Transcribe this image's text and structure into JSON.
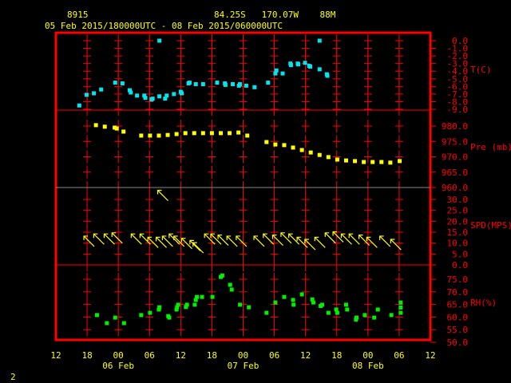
{
  "header": {
    "station": "8915",
    "location": "84.25S   170.07W    88M",
    "period": "05 Feb 2015/180000UTC - 08 Feb 2015/060000UTC"
  },
  "footer": {
    "page_number": "2"
  },
  "colors": {
    "frame": "#ff0000",
    "text": "#ffff00",
    "temperature": "#00e5ee",
    "pressure": "#ffff00",
    "wind": "#ffff00",
    "rh": "#00ee00"
  },
  "chart_data": {
    "type": "scatter",
    "title": "8915  84.25S 170.07W 88M",
    "subtitle": "05 Feb 2015/180000UTC - 08 Feb 2015/060000UTC",
    "x_unit": "hours since 05 Feb 12Z",
    "xlim": [
      0,
      72
    ],
    "x_ticks": [
      "12",
      "18",
      "00",
      "06",
      "12",
      "18",
      "00",
      "06",
      "12",
      "18",
      "00",
      "06",
      "12"
    ],
    "x_day_labels": [
      {
        "label": "06 Feb",
        "hour": 12
      },
      {
        "label": "07 Feb",
        "hour": 36
      },
      {
        "label": "08 Feb",
        "hour": 60
      }
    ],
    "panels": [
      {
        "name": "temperature",
        "label": "T(C)",
        "ylim": [
          -9,
          0
        ],
        "ticks": [
          "0.0",
          "-1.0",
          "-2.0",
          "-3.0",
          "-4.0",
          "-5.0",
          "-6.0",
          "-7.0",
          "-8.0",
          "-9.0"
        ],
        "tick_values": [
          0,
          -1,
          -2,
          -3,
          -4,
          -5,
          -6,
          -7,
          -8,
          -9
        ],
        "points": [
          [
            4.5,
            -8.5
          ],
          [
            5.9,
            -7.1
          ],
          [
            7.3,
            -6.9
          ],
          [
            8.7,
            -6.4
          ],
          [
            11.4,
            -5.5
          ],
          [
            12.8,
            -5.6
          ],
          [
            14.2,
            -6.5
          ],
          [
            14.4,
            -6.8
          ],
          [
            15.6,
            -7.2
          ],
          [
            17.0,
            -7.2
          ],
          [
            17.2,
            -7.5
          ],
          [
            18.4,
            -7.7
          ],
          [
            18.6,
            -7.6
          ],
          [
            19.9,
            -7.3
          ],
          [
            21.0,
            -7.6
          ],
          [
            21.3,
            -7.2
          ],
          [
            22.7,
            -7.0
          ],
          [
            24.0,
            -6.7
          ],
          [
            24.2,
            -6.9
          ],
          [
            25.5,
            -5.6
          ],
          [
            25.7,
            -5.5
          ],
          [
            26.9,
            -5.7
          ],
          [
            28.3,
            -5.7
          ],
          [
            31.0,
            -5.5
          ],
          [
            32.5,
            -5.6
          ],
          [
            32.6,
            -5.8
          ],
          [
            34.0,
            -5.7
          ],
          [
            35.2,
            -5.9
          ],
          [
            35.4,
            -5.7
          ],
          [
            36.6,
            -5.9
          ],
          [
            38.2,
            -6.1
          ],
          [
            40.8,
            -5.5
          ],
          [
            42.2,
            -4.3
          ],
          [
            42.4,
            -3.9
          ],
          [
            43.6,
            -4.3
          ],
          [
            45.1,
            -3.0
          ],
          [
            45.2,
            -3.2
          ],
          [
            46.5,
            -3.0
          ],
          [
            46.6,
            -3.1
          ],
          [
            47.9,
            -2.9
          ],
          [
            48.7,
            -3.3
          ],
          [
            48.9,
            -3.4
          ],
          [
            50.7,
            -3.75
          ],
          [
            52.1,
            -4.4
          ],
          [
            52.2,
            -4.6
          ],
          [
            19.9,
            0.0
          ],
          [
            50.7,
            0.0
          ]
        ]
      },
      {
        "name": "pressure",
        "label": "Pre (mb)",
        "ylim": [
          957.5,
          985
        ],
        "ticks": [
          "980.0",
          "975.0",
          "970.0",
          "965.0",
          "960.0"
        ],
        "tick_values": [
          980,
          975,
          970,
          965,
          960
        ],
        "points": [
          [
            7.7,
            980.3
          ],
          [
            9.4,
            979.8
          ],
          [
            11.3,
            979.5
          ],
          [
            11.7,
            979.2
          ],
          [
            13.0,
            978.2
          ],
          [
            16.4,
            976.9
          ],
          [
            18.1,
            976.9
          ],
          [
            19.8,
            976.9
          ],
          [
            21.5,
            977.1
          ],
          [
            23.2,
            977.4
          ],
          [
            24.9,
            977.7
          ],
          [
            26.6,
            977.7
          ],
          [
            28.3,
            977.7
          ],
          [
            30.0,
            977.7
          ],
          [
            31.7,
            977.7
          ],
          [
            33.4,
            977.7
          ],
          [
            35.1,
            977.9
          ],
          [
            36.8,
            976.9
          ],
          [
            40.5,
            974.8
          ],
          [
            42.2,
            974.0
          ],
          [
            43.9,
            973.8
          ],
          [
            45.6,
            973.0
          ],
          [
            47.3,
            972.2
          ],
          [
            49.0,
            971.4
          ],
          [
            50.7,
            970.6
          ],
          [
            52.4,
            969.9
          ],
          [
            54.1,
            969.1
          ],
          [
            55.8,
            968.8
          ],
          [
            57.5,
            968.6
          ],
          [
            59.2,
            968.3
          ],
          [
            60.9,
            968.3
          ],
          [
            62.6,
            968.3
          ],
          [
            64.3,
            968.1
          ],
          [
            66.1,
            968.6
          ]
        ]
      },
      {
        "name": "wind_speed",
        "label": "SPD(MPS)",
        "ylim": [
          0,
          35
        ],
        "ticks": [
          "30.0",
          "25.0",
          "20.0",
          "15.0",
          "10.0",
          "5.0",
          "0.0"
        ],
        "tick_values": [
          30,
          25,
          20,
          15,
          10,
          5,
          0
        ],
        "wind_direction_deg": 135,
        "points": [
          [
            6.3,
            11
          ],
          [
            8.2,
            12
          ],
          [
            10.2,
            12
          ],
          [
            11.7,
            12.5
          ],
          [
            15.4,
            12
          ],
          [
            17.1,
            12
          ],
          [
            18.6,
            10.5
          ],
          [
            20.2,
            10.5
          ],
          [
            21.4,
            11
          ],
          [
            22.7,
            12
          ],
          [
            23.6,
            11
          ],
          [
            25.1,
            10
          ],
          [
            26.7,
            9
          ],
          [
            27.3,
            8
          ],
          [
            29.5,
            12
          ],
          [
            30.7,
            12
          ],
          [
            32.1,
            11.5
          ],
          [
            33.8,
            11
          ],
          [
            35.6,
            11
          ],
          [
            39.0,
            11
          ],
          [
            40.8,
            12
          ],
          [
            42.6,
            11.5
          ],
          [
            44.2,
            12.5
          ],
          [
            45.7,
            12
          ],
          [
            47.3,
            10.5
          ],
          [
            48.8,
            9.5
          ],
          [
            50.7,
            10.5
          ],
          [
            52.7,
            12.5
          ],
          [
            54.2,
            13
          ],
          [
            55.8,
            12
          ],
          [
            57.3,
            12
          ],
          [
            59.2,
            11.5
          ],
          [
            60.7,
            10.5
          ],
          [
            63.2,
            11
          ],
          [
            65.3,
            9.5
          ],
          [
            20.5,
            32
          ]
        ]
      },
      {
        "name": "relative_humidity",
        "label": "RH(%)",
        "ylim": [
          50,
          80
        ],
        "ticks": [
          "75.0",
          "70.0",
          "65.0",
          "60.0",
          "55.0",
          "50.0"
        ],
        "tick_values": [
          75,
          70,
          65,
          60,
          55,
          50
        ],
        "points": [
          [
            7.9,
            60.8
          ],
          [
            9.8,
            57.6
          ],
          [
            11.4,
            59.8
          ],
          [
            13.1,
            57.6
          ],
          [
            16.4,
            60.8
          ],
          [
            18.1,
            61.7
          ],
          [
            19.8,
            63.0
          ],
          [
            19.9,
            63.9
          ],
          [
            21.6,
            60.4
          ],
          [
            21.8,
            59.8
          ],
          [
            23.2,
            63.0
          ],
          [
            23.3,
            63.9
          ],
          [
            23.5,
            64.9
          ],
          [
            25.0,
            64.0
          ],
          [
            25.2,
            64.9
          ],
          [
            26.7,
            64.9
          ],
          [
            26.9,
            66.8
          ],
          [
            27.1,
            68.0
          ],
          [
            28.1,
            68.0
          ],
          [
            30.1,
            68.0
          ],
          [
            31.7,
            75.9
          ],
          [
            32.0,
            76.5
          ],
          [
            33.5,
            72.8
          ],
          [
            33.8,
            70.9
          ],
          [
            35.4,
            64.9
          ],
          [
            37.1,
            63.9
          ],
          [
            40.5,
            61.7
          ],
          [
            42.2,
            65.8
          ],
          [
            43.9,
            68.0
          ],
          [
            45.6,
            66.8
          ],
          [
            45.7,
            64.9
          ],
          [
            47.3,
            69.0
          ],
          [
            49.3,
            67.0
          ],
          [
            49.5,
            65.8
          ],
          [
            50.9,
            64.4
          ],
          [
            51.2,
            64.9
          ],
          [
            52.4,
            61.7
          ],
          [
            53.9,
            63.0
          ],
          [
            54.1,
            61.7
          ],
          [
            55.8,
            64.9
          ],
          [
            56.0,
            63.0
          ],
          [
            57.7,
            59.0
          ],
          [
            57.8,
            59.8
          ],
          [
            59.4,
            60.8
          ],
          [
            61.9,
            63.0
          ],
          [
            61.2,
            59.8
          ],
          [
            64.5,
            60.8
          ],
          [
            66.3,
            61.7
          ],
          [
            66.3,
            63.8
          ],
          [
            66.3,
            65.8
          ]
        ]
      }
    ]
  }
}
